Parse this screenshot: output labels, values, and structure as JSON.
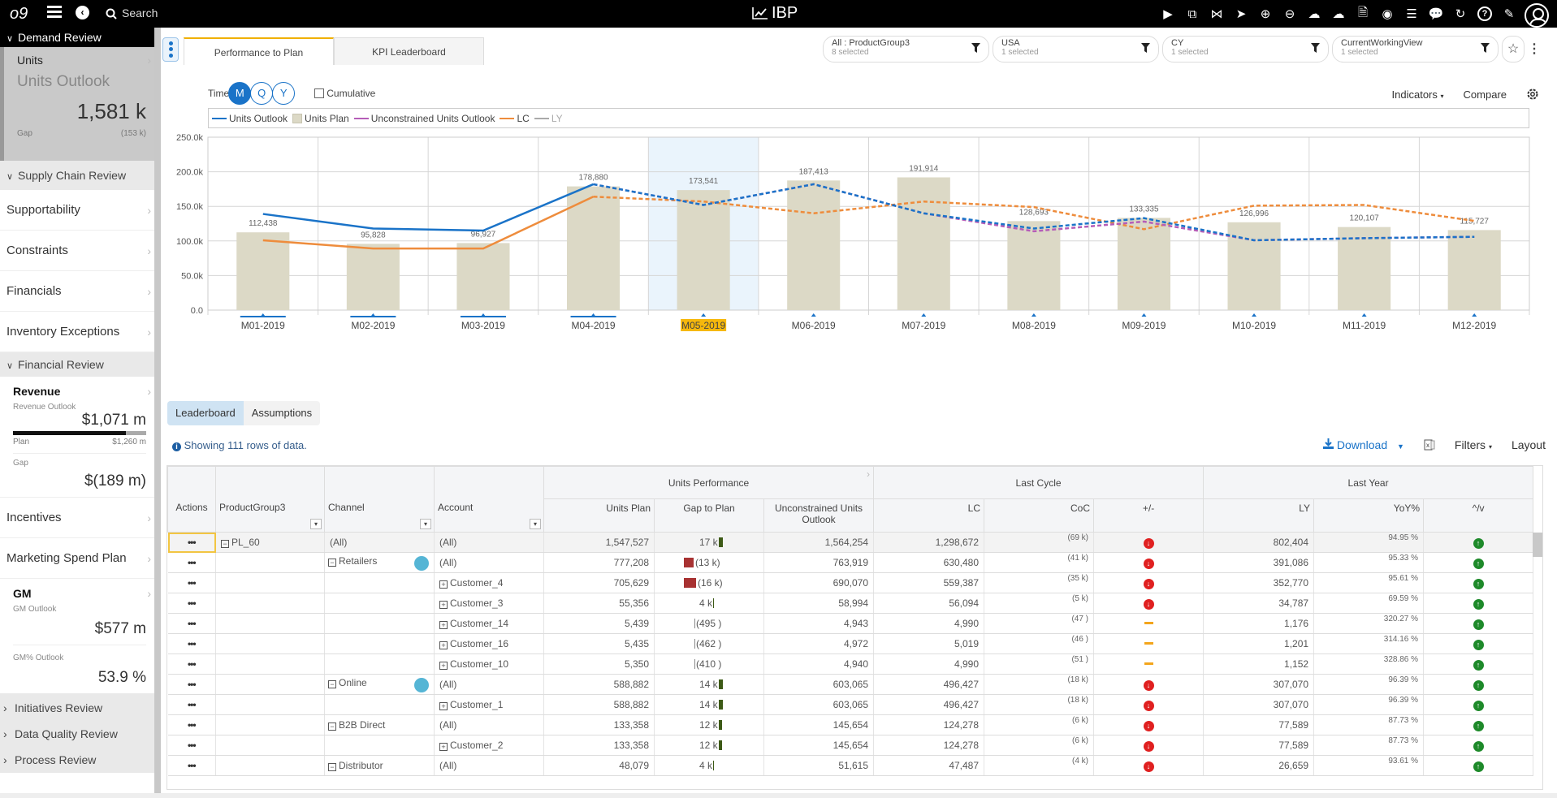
{
  "topbar": {
    "logo": "o9",
    "search_label": "Search",
    "title": "IBP",
    "icons": [
      "play-icon",
      "copy-icon",
      "share-icon",
      "send-icon",
      "plus-circle-icon",
      "minus-circle-icon",
      "cloud-upload-icon",
      "cloud-download-icon",
      "pdf-icon",
      "record-icon",
      "list-icon",
      "chat-icon",
      "refresh-icon",
      "help-icon",
      "edit-icon"
    ]
  },
  "sidebar": {
    "demand_review": "Demand Review",
    "units_card": {
      "label": "Units",
      "sub": "Units Outlook",
      "value": "1,581 k",
      "gap_label": "Gap",
      "gap_value": "(153 k)"
    },
    "supply_chain_review": "Supply Chain Review",
    "supply_items": [
      "Supportability",
      "Constraints",
      "Financials",
      "Inventory Exceptions"
    ],
    "financial_review": "Financial Review",
    "revenue": {
      "title": "Revenue",
      "sub": "Revenue Outlook",
      "value": "$1,071 m",
      "progress": 0.85,
      "plan_label": "Plan",
      "plan_value": "$1,260 m",
      "gap_label": "Gap",
      "gap_value": "$(189 m)"
    },
    "fin_items": [
      "Incentives",
      "Marketing Spend Plan"
    ],
    "gm": {
      "title": "GM",
      "sub": "GM Outlook",
      "value": "$577 m",
      "pct_label": "GM% Outlook",
      "pct_value": "53.9 %"
    },
    "footer_sections": [
      "Initiatives Review",
      "Data Quality Review",
      "Process Review"
    ]
  },
  "tabs": [
    "Performance to Plan",
    "KPI Leaderboard"
  ],
  "filters": [
    {
      "name": "All : ProductGroup3",
      "sel": "8 selected"
    },
    {
      "name": "USA",
      "sel": "1 selected"
    },
    {
      "name": "CY",
      "sel": "1 selected"
    },
    {
      "name": "CurrentWorkingView",
      "sel": "1 selected"
    }
  ],
  "time": {
    "label": "Time",
    "buttons": [
      "M",
      "Q",
      "Y"
    ],
    "active": "M",
    "cumulative": "Cumulative"
  },
  "controls": {
    "indicators": "Indicators",
    "compare": "Compare"
  },
  "colors": {
    "outlook": "#1a73c8",
    "plan": "#dcd9c6",
    "unconstrained": "#b55db8",
    "lc": "#ee8c3c",
    "ly": "#aaaaaa",
    "highlight": "#f6b80c"
  },
  "chart_data": {
    "type": "bar",
    "title": "",
    "xlabel": "",
    "ylabel": "",
    "ylim": [
      0,
      250000
    ],
    "yticks": [
      "0.0",
      "50.0k",
      "100.0k",
      "150.0k",
      "200.0k",
      "250.0k"
    ],
    "categories": [
      "M01-2019",
      "M02-2019",
      "M03-2019",
      "M04-2019",
      "M05-2019",
      "M06-2019",
      "M07-2019",
      "M08-2019",
      "M09-2019",
      "M10-2019",
      "M11-2019",
      "M12-2019"
    ],
    "highlighted_category": "M05-2019",
    "legend": [
      "Units Outlook",
      "Units Plan",
      "Unconstrained Units Outlook",
      "LC",
      "LY"
    ],
    "legend_position": "top",
    "grid": true,
    "series": [
      {
        "name": "Units Plan",
        "type": "bar",
        "values": [
          112438,
          95828,
          96927,
          178880,
          173541,
          187413,
          191914,
          128693,
          133335,
          126996,
          120107,
          115727
        ],
        "labels": [
          "112,438",
          "95,828",
          "96,927",
          "178,880",
          "173,541",
          "187,413",
          "191,914",
          "128,693",
          "133,335",
          "126,996",
          "120,107",
          "115,727"
        ]
      },
      {
        "name": "Units Outlook",
        "type": "line",
        "values": [
          139000,
          118000,
          115000,
          182000,
          152000,
          182000,
          140000,
          118000,
          133000,
          101000,
          104000,
          106000
        ],
        "dashed_from_index": 3
      },
      {
        "name": "Unconstrained Units Outlook",
        "type": "line",
        "values": [
          null,
          null,
          null,
          182000,
          152000,
          182000,
          140000,
          114000,
          128000,
          101000,
          104000,
          106000
        ],
        "dashed_from_index": 3
      },
      {
        "name": "LC",
        "type": "line",
        "values": [
          101000,
          89000,
          89000,
          164000,
          157000,
          140000,
          157000,
          149000,
          117000,
          151000,
          152000,
          129000
        ],
        "dashed_from_index": 3
      }
    ]
  },
  "leaderboard": {
    "tabs": [
      "Leaderboard",
      "Assumptions"
    ],
    "info": "Showing 111 rows of data.",
    "download": "Download",
    "filters": "Filters",
    "layout": "Layout",
    "groups": [
      "Units Performance",
      "Last Cycle",
      "Last Year"
    ],
    "columns": [
      "Actions",
      "ProductGroup3",
      "Channel",
      "Account",
      "Units Plan",
      "Gap to Plan",
      "Unconstrained Units Outlook",
      "LC",
      "CoC",
      "+/-",
      "LY",
      "YoY%",
      "^/v"
    ],
    "rows": [
      {
        "pg": "PL_60",
        "ch": "(All)",
        "acc": "(All)",
        "plan": "1,547,527",
        "gap": "17 k",
        "gapdir": "pos",
        "gapw": 5,
        "unc": "1,564,254",
        "lc": "1,298,672",
        "coc": "(69 k)",
        "cocicon": "down",
        "ly": "802,404",
        "yoy": "94.95 %",
        "yoyicon": "up",
        "pgx": "minus",
        "chx": "",
        "accx": ""
      },
      {
        "pg": "",
        "ch": "Retailers",
        "acc": "(All)",
        "plan": "777,208",
        "gap": "(13 k)",
        "gapdir": "neg",
        "gapw": 12,
        "unc": "763,919",
        "lc": "630,480",
        "coc": "(41 k)",
        "cocicon": "down",
        "ly": "391,086",
        "yoy": "95.33 %",
        "yoyicon": "up",
        "chx": "minus",
        "bubble": true,
        "accx": ""
      },
      {
        "pg": "",
        "ch": "",
        "acc": "Customer_4",
        "plan": "705,629",
        "gap": "(16 k)",
        "gapdir": "neg",
        "gapw": 15,
        "unc": "690,070",
        "lc": "559,387",
        "coc": "(35 k)",
        "cocicon": "down",
        "ly": "352,770",
        "yoy": "95.61 %",
        "yoyicon": "up",
        "accx": "plus"
      },
      {
        "pg": "",
        "ch": "",
        "acc": "Customer_3",
        "plan": "55,356",
        "gap": "4 k",
        "gapdir": "pos",
        "gapw": 1,
        "unc": "58,994",
        "lc": "56,094",
        "coc": "(5 k)",
        "cocicon": "down",
        "ly": "34,787",
        "yoy": "69.59 %",
        "yoyicon": "up",
        "accx": "plus"
      },
      {
        "pg": "",
        "ch": "",
        "acc": "Customer_14",
        "plan": "5,439",
        "gap": "(495 )",
        "gapdir": "negtick",
        "gapw": 1,
        "unc": "4,943",
        "lc": "4,990",
        "coc": "(47 )",
        "cocicon": "neutral",
        "ly": "1,176",
        "yoy": "320.27 %",
        "yoyicon": "up",
        "accx": "plus"
      },
      {
        "pg": "",
        "ch": "",
        "acc": "Customer_16",
        "plan": "5,435",
        "gap": "(462 )",
        "gapdir": "negtick",
        "gapw": 1,
        "unc": "4,972",
        "lc": "5,019",
        "coc": "(46 )",
        "cocicon": "neutral",
        "ly": "1,201",
        "yoy": "314.16 %",
        "yoyicon": "up",
        "accx": "plus"
      },
      {
        "pg": "",
        "ch": "",
        "acc": "Customer_10",
        "plan": "5,350",
        "gap": "(410 )",
        "gapdir": "negtick",
        "gapw": 1,
        "unc": "4,940",
        "lc": "4,990",
        "coc": "(51 )",
        "cocicon": "neutral",
        "ly": "1,152",
        "yoy": "328.86 %",
        "yoyicon": "up",
        "accx": "plus"
      },
      {
        "pg": "",
        "ch": "Online",
        "acc": "(All)",
        "plan": "588,882",
        "gap": "14 k",
        "gapdir": "pos",
        "gapw": 5,
        "unc": "603,065",
        "lc": "496,427",
        "coc": "(18 k)",
        "cocicon": "down",
        "ly": "307,070",
        "yoy": "96.39 %",
        "yoyicon": "up",
        "chx": "minus",
        "bubble": true,
        "accx": ""
      },
      {
        "pg": "",
        "ch": "",
        "acc": "Customer_1",
        "plan": "588,882",
        "gap": "14 k",
        "gapdir": "pos",
        "gapw": 5,
        "unc": "603,065",
        "lc": "496,427",
        "coc": "(18 k)",
        "cocicon": "down",
        "ly": "307,070",
        "yoy": "96.39 %",
        "yoyicon": "up",
        "accx": "plus"
      },
      {
        "pg": "",
        "ch": "B2B Direct",
        "acc": "(All)",
        "plan": "133,358",
        "gap": "12 k",
        "gapdir": "pos",
        "gapw": 4,
        "unc": "145,654",
        "lc": "124,278",
        "coc": "(6 k)",
        "cocicon": "down",
        "ly": "77,589",
        "yoy": "87.73 %",
        "yoyicon": "up",
        "chx": "minus",
        "accx": ""
      },
      {
        "pg": "",
        "ch": "",
        "acc": "Customer_2",
        "plan": "133,358",
        "gap": "12 k",
        "gapdir": "pos",
        "gapw": 4,
        "unc": "145,654",
        "lc": "124,278",
        "coc": "(6 k)",
        "cocicon": "down",
        "ly": "77,589",
        "yoy": "87.73 %",
        "yoyicon": "up",
        "accx": "plus"
      },
      {
        "pg": "",
        "ch": "Distributor",
        "acc": "(All)",
        "plan": "48,079",
        "gap": "4 k",
        "gapdir": "pos",
        "gapw": 1,
        "unc": "51,615",
        "lc": "47,487",
        "coc": "(4 k)",
        "cocicon": "down",
        "ly": "26,659",
        "yoy": "93.61 %",
        "yoyicon": "up",
        "chx": "minus",
        "accx": ""
      }
    ]
  }
}
